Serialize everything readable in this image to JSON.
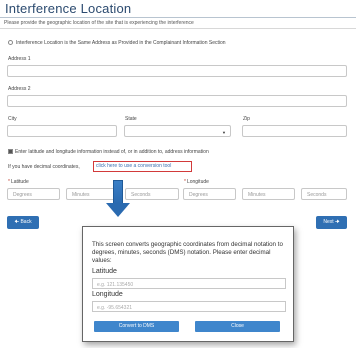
{
  "form": {
    "title": "Interference Location",
    "subtitle": "Please provide the geographic location of the site that is experiencing the interference",
    "same_address_label": "Interference Location is the Same Address as Provided in the Complainant Information Section",
    "address1_label": "Address 1",
    "address2_label": "Address 2",
    "city_label": "City",
    "state_label": "State",
    "zip_label": "Zip",
    "latlong_checkbox_label": "Enter latitude and longitude information instead of, or in addition to, address information",
    "decimal_prompt": "If you have decimal coordinates,",
    "conversion_link": "click here to use a conversion tool",
    "latitude_label": "Latitude",
    "longitude_label": "Longitude",
    "required_mark": "*",
    "degrees_placeholder": "Degrees",
    "minutes_placeholder": "Minutes",
    "seconds_placeholder": "Seconds",
    "back_button": "Back",
    "next_button": "Next"
  },
  "modal": {
    "description": "This screen converts geographic coordinates from decimal notation to degrees, minutes, seconds (DMS) notation. Please enter decimal values:",
    "latitude_label": "Latitude",
    "latitude_placeholder": "e.g. 121.135450",
    "longitude_label": "Longitude",
    "longitude_placeholder": "e.g. -95.654321",
    "convert_button": "Convert to DMS",
    "close_button": "Close"
  },
  "colors": {
    "title": "#2b4a6f",
    "primary_button": "#2f6fb3",
    "highlight_box": "#d23a3a",
    "link": "#3a6fb0"
  },
  "icons": {
    "back": "arrow-left-icon",
    "next": "arrow-right-icon",
    "callout": "down-arrow-icon"
  }
}
